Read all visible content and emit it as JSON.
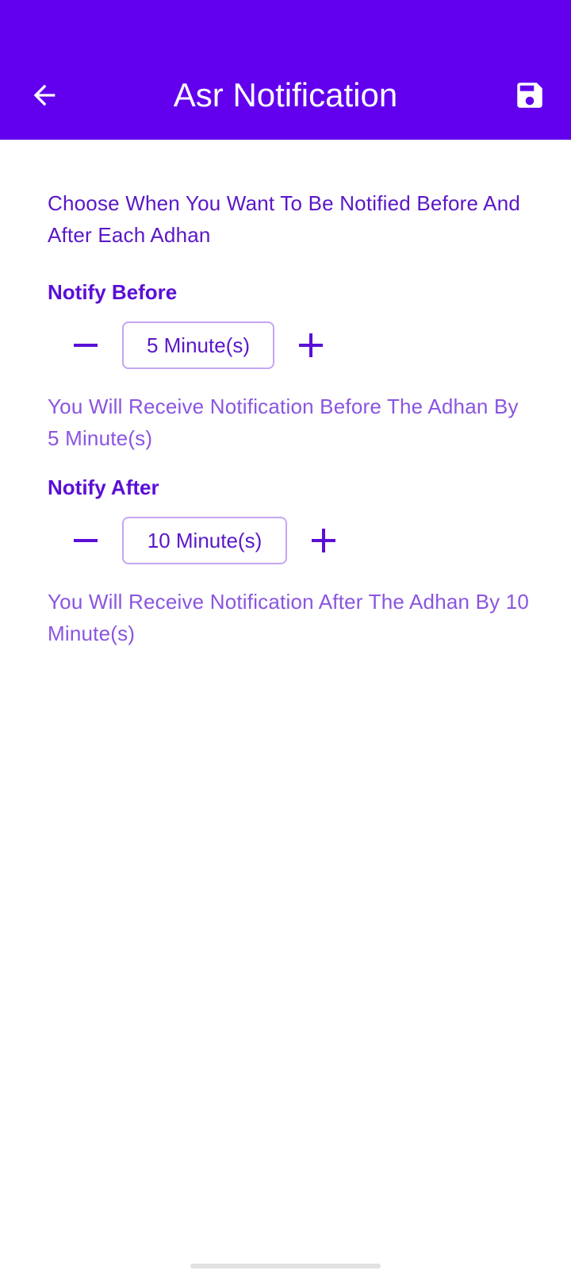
{
  "app_bar": {
    "title": "Asr Notification",
    "back_icon": "arrow-left-icon",
    "save_icon": "save-icon",
    "color": "#6200EE"
  },
  "intro_text": "Choose When You Want To Be Notified Before And After Each Adhan",
  "notify_before": {
    "heading": "Notify Before",
    "value": "5 Minute(s)",
    "minus_icon": "minus-icon",
    "plus_icon": "plus-icon",
    "helper": "You Will Receive Notification Before The Adhan By 5 Minute(s)"
  },
  "notify_after": {
    "heading": "Notify After",
    "value": "10 Minute(s)",
    "minus_icon": "minus-icon",
    "plus_icon": "plus-icon",
    "helper": "You Will Receive Notification After The Adhan By 10 Minute(s)"
  },
  "colors": {
    "accent": "#6200EE",
    "heading": "#5a0fd6",
    "helper": "#8a55e0"
  }
}
